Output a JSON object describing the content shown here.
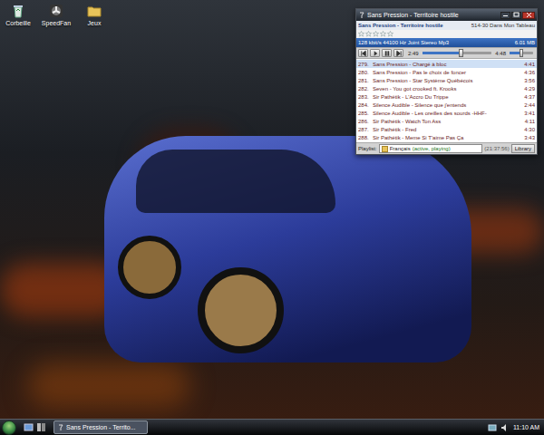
{
  "desktop": {
    "icons": [
      {
        "label": "Corbeille",
        "kind": "bin"
      },
      {
        "label": "SpeedFan",
        "kind": "fan"
      },
      {
        "label": "Jeux",
        "kind": "folder"
      }
    ]
  },
  "player": {
    "title": "Sans Pression - Territoire hostile",
    "now_playing": {
      "track": "Sans Pression - Territoire hostile",
      "album": "514-30 Dans Mon Tableau",
      "stars": 0,
      "format": "128 kbit/s 44100 Hz Joint Stereo Mp3",
      "size": "6.01 MB"
    },
    "elapsed": "2:49",
    "seek": {
      "level": 0.55
    },
    "length": "4:48",
    "volume": {
      "level": 0.5
    },
    "playlist": [
      {
        "number": "279.",
        "title": "Sans Pression - Chargé à bloc",
        "duration": "4:41",
        "selected": true
      },
      {
        "number": "280.",
        "title": "Sans Pression - Pas le choix de foncer",
        "duration": "4:36",
        "selected": false
      },
      {
        "number": "281.",
        "title": "Sans Pression - Star Système Québécois",
        "duration": "3:56",
        "selected": false
      },
      {
        "number": "282.",
        "title": "Seven - You got crooked ft. Krooks",
        "duration": "4:29",
        "selected": false
      },
      {
        "number": "283.",
        "title": "Sir Pathétik - L'Accro Du Trippe",
        "duration": "4:37",
        "selected": false
      },
      {
        "number": "284.",
        "title": "Silence Audible - Silence que j'entends",
        "duration": "2:44",
        "selected": false
      },
      {
        "number": "285.",
        "title": "Silence Audible - Les oreilles des sourds -HHF-",
        "duration": "3:41",
        "selected": false
      },
      {
        "number": "286.",
        "title": "Sir Pathétik - Watch Ton Ass",
        "duration": "4:11",
        "selected": false
      },
      {
        "number": "287.",
        "title": "Sir Pathétik - Fred",
        "duration": "4:30",
        "selected": false
      },
      {
        "number": "288.",
        "title": "Sir Pathétik - Meme Si T'aime Pas Ça",
        "duration": "3:43",
        "selected": false
      }
    ],
    "footer": {
      "label": "Playlist:",
      "playlist_name": "Français",
      "playlist_state": "(active, playing)",
      "total": "(21:37:56)",
      "library": "Library"
    }
  },
  "taskbar": {
    "tasks": [
      {
        "label": "Sans Pression - Territo...",
        "selected": true
      }
    ],
    "clock": "11:10 AM"
  }
}
